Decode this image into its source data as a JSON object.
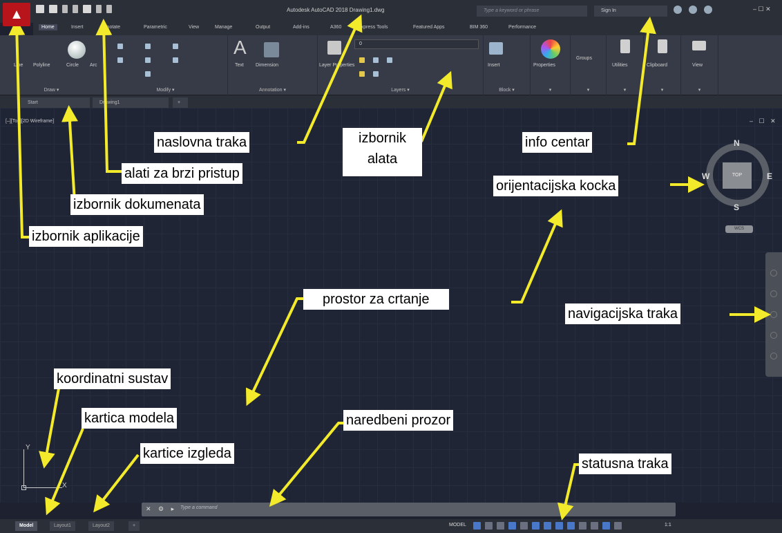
{
  "app": {
    "title": "Autodesk AutoCAD 2018   Drawing1.dwg",
    "search_placeholder": "Type a keyword or phrase",
    "sign_in": "Sign In",
    "window_controls": "– ☐ ✕"
  },
  "ribbon_tabs": [
    "Home",
    "Insert",
    "Annotate",
    "Parametric",
    "View",
    "Manage",
    "Output",
    "Add-ins",
    "A360",
    "Express Tools",
    "Featured Apps",
    "BIM 360",
    "Performance"
  ],
  "panels": {
    "draw": {
      "label": "Draw ▾",
      "tools": [
        "Line",
        "Polyline",
        "Circle",
        "Arc"
      ]
    },
    "modify": {
      "label": "Modify ▾"
    },
    "annotation": {
      "label": "Annotation ▾",
      "tools": [
        "Text",
        "Dimension"
      ]
    },
    "layers": {
      "label": "Layers ▾",
      "tools": [
        "Layer Properties"
      ],
      "current_layer": "0"
    },
    "block": {
      "label": "Block ▾",
      "tools": [
        "Insert"
      ]
    },
    "properties": {
      "label": "▾",
      "tools": [
        "Properties"
      ]
    },
    "groups": {
      "label": "▾",
      "tools": [
        "Groups"
      ]
    },
    "utilities": {
      "label": "▾",
      "tools": [
        "Utilities"
      ]
    },
    "clipboard": {
      "label": "▾",
      "tools": [
        "Clipboard"
      ]
    },
    "view": {
      "label": "▾",
      "tools": [
        "View"
      ]
    }
  },
  "file_tabs": [
    "Start",
    "Drawing1",
    "+"
  ],
  "viewport_label": "[–][Top][2D Wireframe]",
  "viewcube": {
    "face": "TOP",
    "n": "N",
    "s": "S",
    "e": "E",
    "w": "W",
    "wcs": "WCS"
  },
  "ucs": {
    "y": "Y",
    "x": "X"
  },
  "command": {
    "placeholder": "Type a command"
  },
  "layout_tabs": [
    "Model",
    "Layout1",
    "Layout2",
    "+"
  ],
  "status": {
    "model": "MODEL",
    "scale": "1:1"
  },
  "annotations": {
    "title_bar": "naslovna traka",
    "quick_access": "alati za brzi pristup",
    "doc_menu": "izbornik dokumenata",
    "app_menu": "izbornik aplikacije",
    "ribbon_line1": "izbornik",
    "ribbon_line2": "alata",
    "info_center": "info centar",
    "viewcube": "orijentacijska kocka",
    "drawing_space": "prostor za crtanje",
    "nav_bar": "navigacijska traka",
    "coord_system": "koordinatni sustav",
    "model_tab": "kartica modela",
    "layout_tabs": "kartice izgleda",
    "command_window": "naredbeni prozor",
    "status_bar": "statusna traka"
  },
  "colors": {
    "app_red": "#b8141b",
    "arrow_yellow": "#f2ea2a",
    "canvas": "#1f2535"
  }
}
